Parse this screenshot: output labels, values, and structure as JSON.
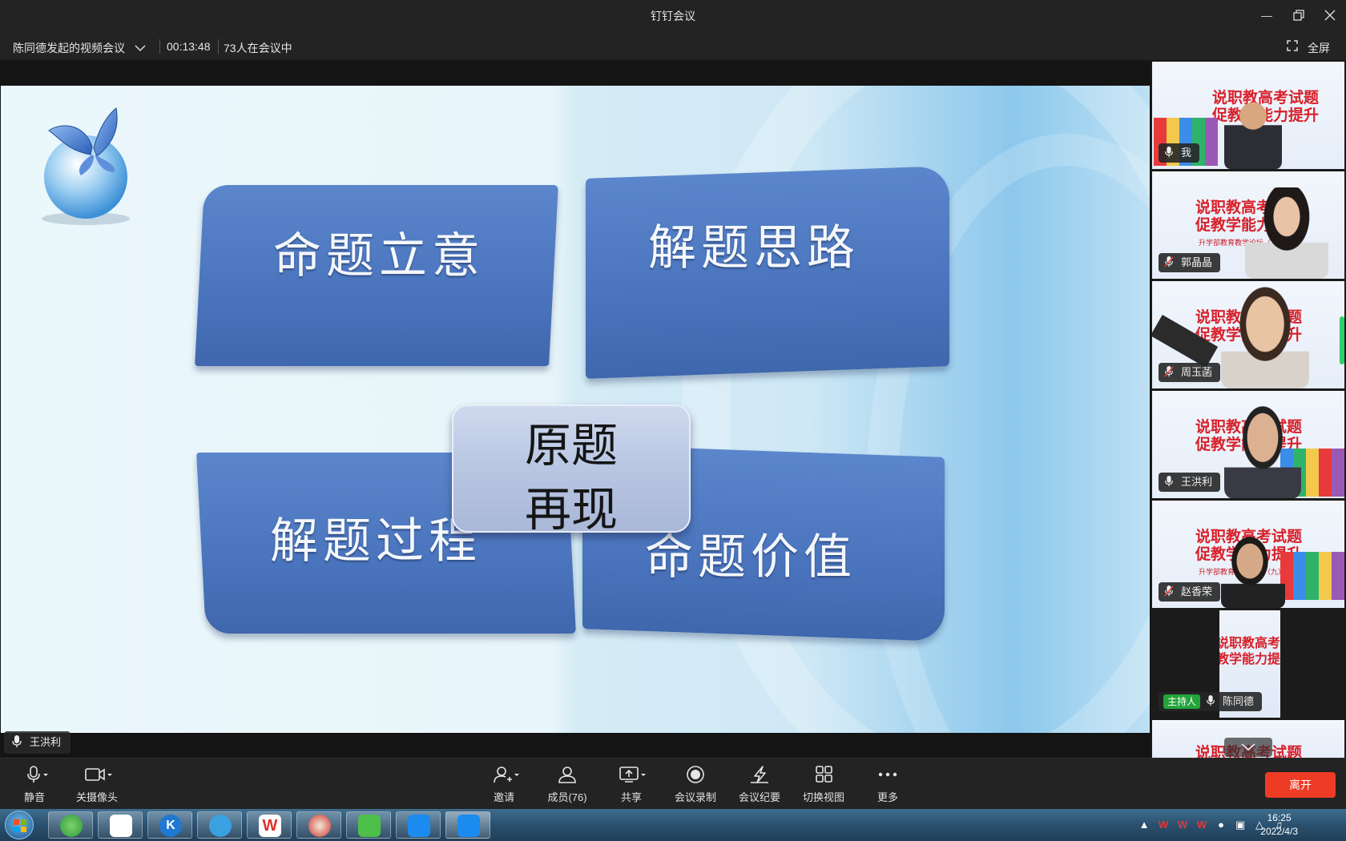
{
  "window": {
    "title": "钉钉会议"
  },
  "meeting": {
    "name": "陈同德发起的视频会议",
    "duration": "00:13:48",
    "attendance": "73人在会议中",
    "fullscreen_label": "全屏"
  },
  "slide": {
    "center_line1": "原题",
    "center_line2": "再现",
    "tl": "命题立意",
    "tr": "解题思路",
    "bl": "解题过程",
    "br": "命题价值"
  },
  "active_speaker": "王洪利",
  "participants": [
    {
      "name": "我",
      "muted": false
    },
    {
      "name": "郭晶晶",
      "muted": true
    },
    {
      "name": "周玉菡",
      "muted": true
    },
    {
      "name": "王洪利",
      "muted": false
    },
    {
      "name": "赵香荣",
      "muted": true
    },
    {
      "name": "陈同德",
      "muted": false,
      "host_label": "主持人"
    }
  ],
  "tile_slide_text": {
    "line1": "说职教高考试题",
    "line2": "促教学能力提升",
    "sub": "升学部教育教学论坛（九）"
  },
  "toolbar": {
    "mute": "静音",
    "camera": "关摄像头",
    "invite": "邀请",
    "members": "成员(76)",
    "share": "共享",
    "record": "会议录制",
    "minutes": "会议纪要",
    "switch_view": "切换视图",
    "more": "更多",
    "leave": "离开"
  },
  "taskbar": {
    "time": "16:25",
    "date": "2022/4/3"
  },
  "colors": {
    "leave": "#ee3b26",
    "host_badge": "#23a53a",
    "tile_blue": "#4a74bd",
    "slide_red": "#d8202a"
  }
}
